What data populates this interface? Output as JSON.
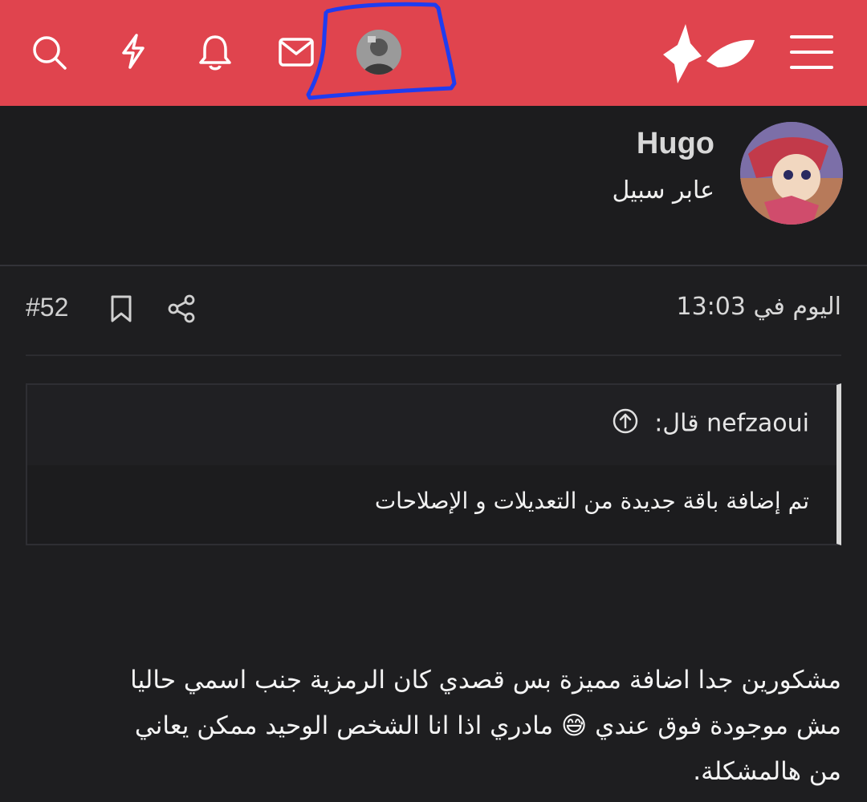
{
  "colors": {
    "topbar": "#e0444e",
    "background": "#1e1e20",
    "text": "#f4f4f4",
    "highlight_stroke": "#1f3cf0"
  },
  "topbar": {
    "icons": [
      "search-icon",
      "flash-icon",
      "bell-icon",
      "mail-icon",
      "user-avatar",
      "logo-icon",
      "menu-icon"
    ]
  },
  "author": {
    "name": "Hugo",
    "title": "عابر سبيل"
  },
  "post": {
    "date": "اليوم في 13:03",
    "number": "#52",
    "quote_author": "nefzaoui قال:",
    "quote_text": "تم إضافة باقة جديدة من التعديلات و الإصلاحات",
    "body_line1": "مشكورين جدا اضافة مميزة بس قصدي كان الرمزية جنب اسمي حاليا",
    "body_line2": "مش موجودة فوق عندي 😅 مادري اذا انا الشخص الوحيد ممكن يعاني",
    "body_line3": "من هالمشكلة."
  }
}
